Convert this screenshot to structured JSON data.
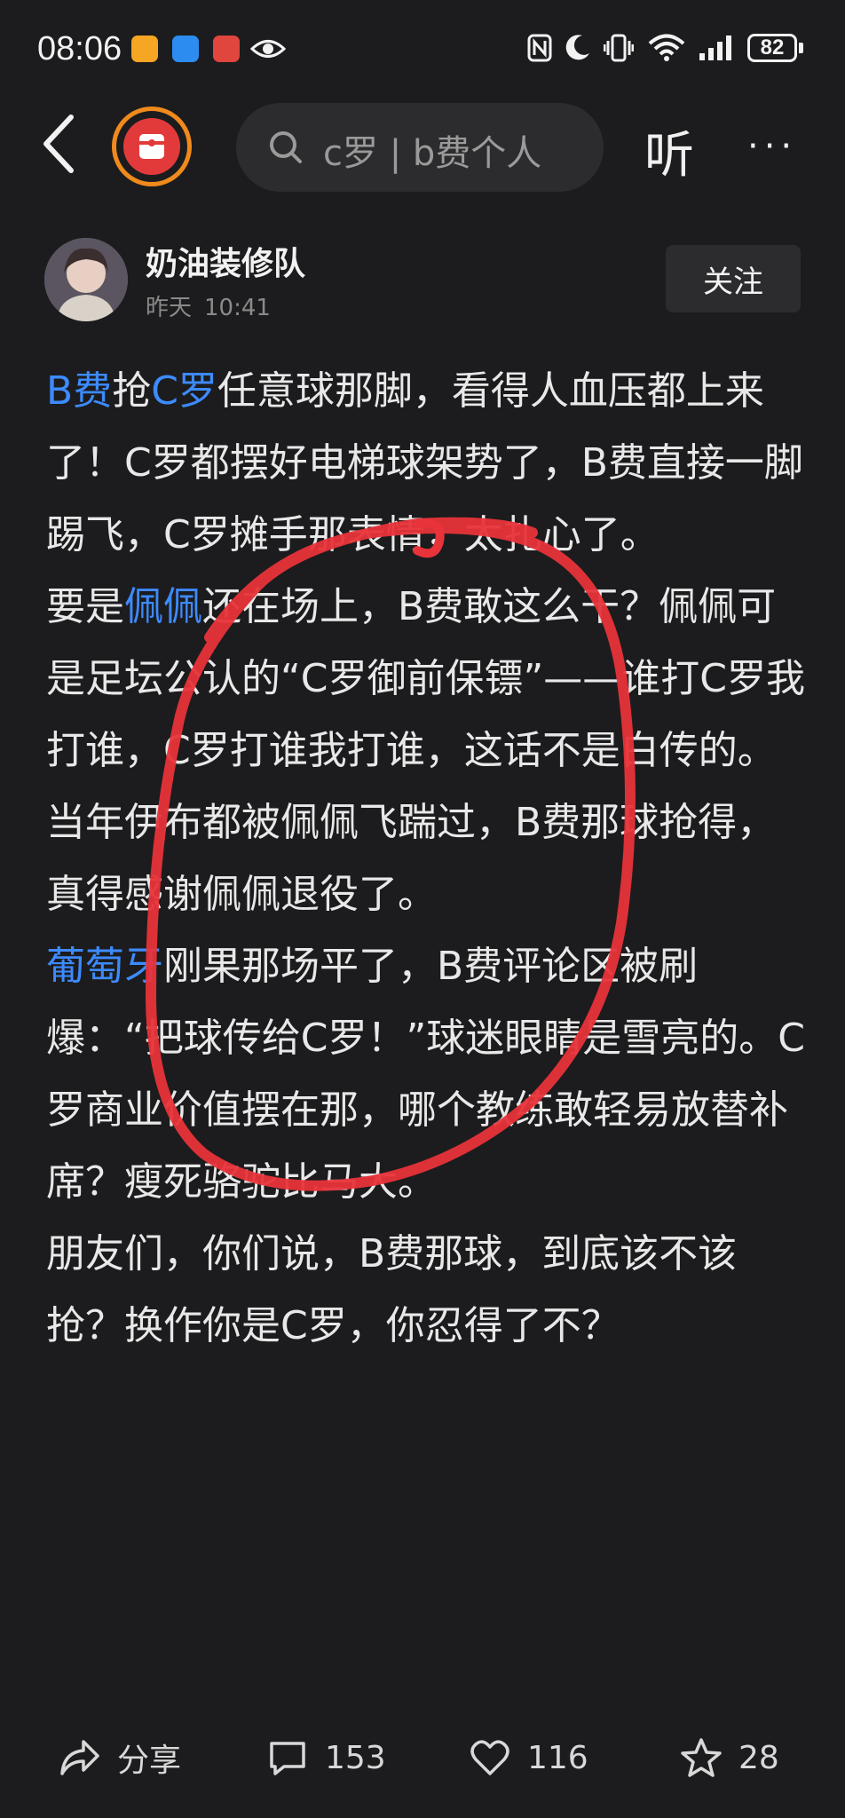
{
  "status_bar": {
    "time": "08:06",
    "battery": "82",
    "icons": [
      "app-icon-orange",
      "app-icon-blue-shield",
      "app-icon-red",
      "eye-icon",
      "nfc-icon",
      "moon-icon",
      "vibrate-icon",
      "wifi-icon",
      "signal-icon",
      "battery-icon"
    ]
  },
  "nav": {
    "search_text": "c罗 | b费个人",
    "listen_label": "听",
    "more_label": "···"
  },
  "author": {
    "name": "奶油装修队",
    "date": "昨天",
    "time": "10:41",
    "follow_label": "关注"
  },
  "post": {
    "p1": {
      "link1": "B费",
      "t1": "抢",
      "link2": "C罗",
      "t2": "任意球那脚，看得人血压都上来了！C罗都摆好电梯球架势了，B费直接一脚踢飞，C罗摊手那表情，太扎心了。"
    },
    "p2": {
      "t0": "要是",
      "link": "佩佩",
      "t1": "还在场上，B费敢这么干？佩佩可是足坛公认的“C罗御前保镖”——谁打C罗我打谁，C罗打谁我打谁，这话不是白传的。当年伊布都被佩佩飞踹过，B费那球抢得，真得感谢佩佩退役了。"
    },
    "p3": {
      "link": "葡萄牙",
      "t1": "刚果那场平了，B费评论区被刷爆：“把球传给C罗！”球迷眼睛是雪亮的。C罗商业价值摆在那，哪个教练敢轻易放替补席？瘦死骆驼比马大。"
    },
    "p4": {
      "t1": "朋友们，你们说，B费那球，到底该不该抢？换作你是C罗，你忍得了不？"
    }
  },
  "footer": {
    "share_label": "分享",
    "comments_count": "153",
    "likes_count": "116",
    "favorites_count": "28"
  },
  "colors": {
    "background": "#1c1c1e",
    "link": "#3d8bff",
    "annotation": "#e8333a",
    "avatar_ring": "#f08a1c"
  }
}
